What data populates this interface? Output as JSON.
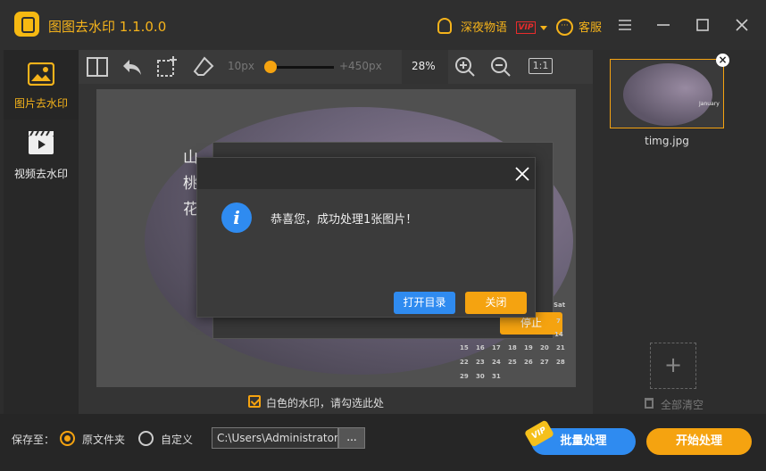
{
  "app": {
    "title": "图图去水印  1.1.0.0"
  },
  "header": {
    "username": "深夜物语",
    "vip_label": "VIP",
    "service_label": "客服"
  },
  "sidebar": {
    "items": [
      {
        "label": "图片去水印"
      },
      {
        "label": "视频去水印"
      }
    ]
  },
  "toolbar": {
    "brush_min": "10px",
    "brush_max": "+450px",
    "zoom": "28%",
    "fit_label": "1:1",
    "brush_fraction": 0.0
  },
  "canvas": {
    "image_text": [
      "山",
      "桃",
      "花"
    ],
    "stop_label": "停止",
    "calendar": {
      "sat_label": "Sat",
      "rows": [
        [
          "15",
          "16",
          "17",
          "18",
          "19",
          "20",
          "21"
        ],
        [
          "22",
          "23",
          "24",
          "25",
          "26",
          "27",
          "28"
        ],
        [
          "29",
          "30",
          "31"
        ]
      ],
      "right_col": [
        "7",
        "14"
      ]
    }
  },
  "watermark_option": {
    "label": "白色的水印，请勾选此处",
    "checked": true
  },
  "right_panel": {
    "file_name": "timg.jpg",
    "thumb_text": "January",
    "add_label": "+",
    "clear_label": "全部清空"
  },
  "bottom": {
    "save_to_label": "保存至：",
    "options": [
      {
        "label": "原文件夹",
        "selected": true
      },
      {
        "label": "自定义",
        "selected": false
      }
    ],
    "path": "C:\\Users\\Administrator",
    "browse_label": "...",
    "batch_label": "批量处理",
    "batch_vip": "VIP",
    "start_label": "开始处理"
  },
  "dialog": {
    "message": "恭喜您，成功处理1张图片！",
    "open_folder_label": "打开目录",
    "close_label": "关闭"
  },
  "colors": {
    "accent": "#f5a310",
    "blue": "#2f8bf0",
    "bg": "#2d2d2d"
  }
}
